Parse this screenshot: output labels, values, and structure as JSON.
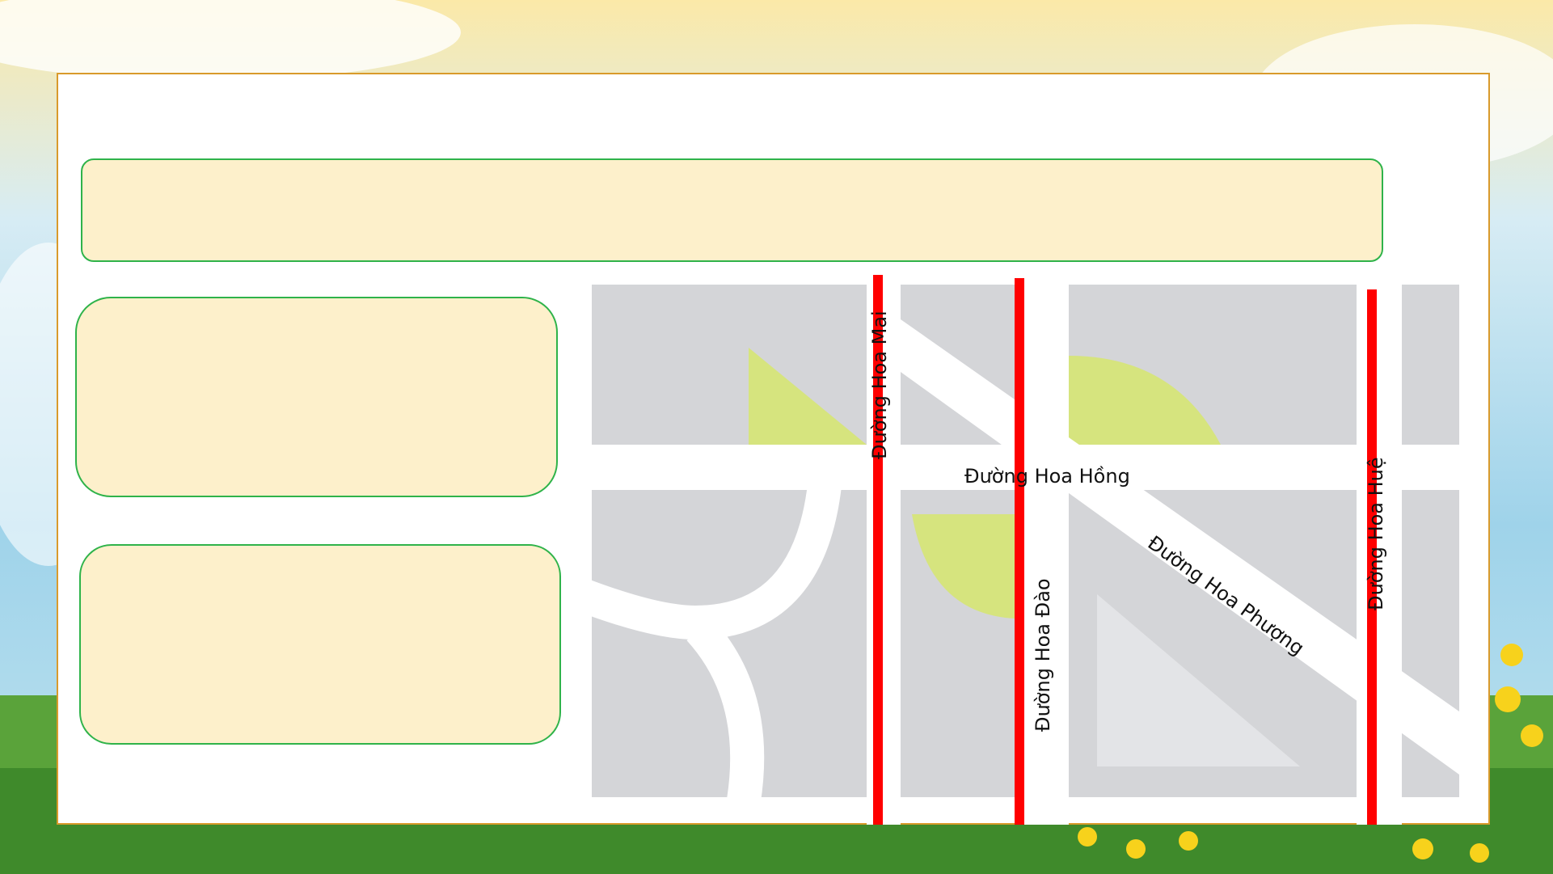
{
  "map": {
    "streets": {
      "hoa_hong": "Đường Hoa Hồng",
      "hoa_phuong": "Đường Hoa Phượng",
      "hoa_mai": "Đường Hoa Mai",
      "hoa_dao": "Đường Hoa Đào",
      "hoa_hue": "Đường Hoa Huệ"
    },
    "colors": {
      "block": "#d4d5d8",
      "road": "#ffffff",
      "park": "#d6e47e",
      "plaza": "#e3e4e7",
      "highlight": "#ff0000"
    }
  },
  "boxes": {
    "fill": "#fdf0cb",
    "border": "#2fb34a"
  }
}
